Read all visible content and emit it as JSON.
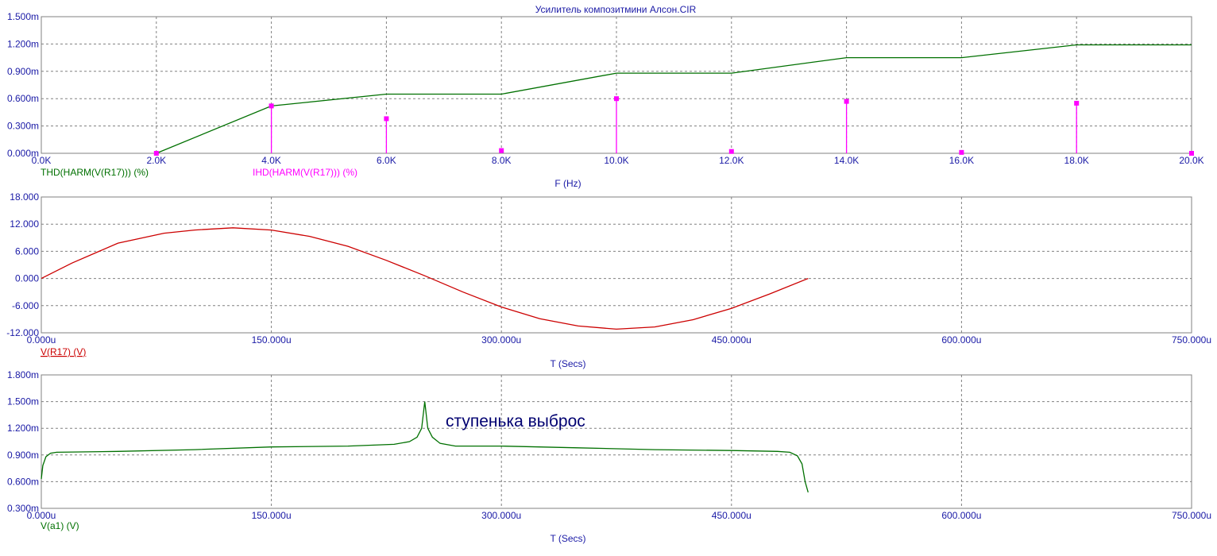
{
  "chart_data": [
    {
      "type": "line",
      "title": "Усилитель  композитмини Алсон.CIR",
      "xlabel": "F (Hz)",
      "xlim": [
        0,
        20000
      ],
      "ylim": [
        0,
        0.0015
      ],
      "grid": true,
      "x_ticks": [
        "0.0K",
        "2.0K",
        "4.0K",
        "6.0K",
        "8.0K",
        "10.0K",
        "12.0K",
        "14.0K",
        "16.0K",
        "18.0K",
        "20.0K"
      ],
      "y_ticks": [
        "0.000m",
        "0.300m",
        "0.600m",
        "0.900m",
        "1.200m",
        "1.500m"
      ],
      "series": [
        {
          "name": "THD(HARM(V(R17))) (%)",
          "color": "#007000",
          "style": "line",
          "x": [
            2000,
            4000,
            6000,
            8000,
            10000,
            12000,
            14000,
            16000,
            18000,
            20000
          ],
          "values": [
            0.0,
            0.00052,
            0.00065,
            0.00065,
            0.00088,
            0.00088,
            0.00105,
            0.00105,
            0.00119,
            0.00119
          ]
        },
        {
          "name": "IHD(HARM(V(R17))) (%)",
          "color": "#ff00ff",
          "style": "stem",
          "x": [
            2000,
            4000,
            6000,
            8000,
            10000,
            12000,
            14000,
            16000,
            18000,
            20000
          ],
          "values": [
            0.0,
            0.00052,
            0.00038,
            3e-05,
            0.0006,
            2e-05,
            0.00057,
            1e-05,
            0.00055,
            0.0
          ]
        }
      ]
    },
    {
      "type": "line",
      "xlabel": "T (Secs)",
      "xlim": [
        0,
        0.00075
      ],
      "ylim": [
        -12,
        18
      ],
      "grid": true,
      "x_ticks": [
        "0.000u",
        "150.000u",
        "300.000u",
        "450.000u",
        "600.000u",
        "750.000u"
      ],
      "y_ticks": [
        "-12.000",
        "-6.000",
        "0.000",
        "6.000",
        "12.000",
        "18.000"
      ],
      "series": [
        {
          "name": "V(R17) (V)",
          "color": "#cc0000",
          "x": [
            0,
            2e-05,
            5e-05,
            8e-05,
            0.0001,
            0.000125,
            0.00015,
            0.000175,
            0.0002,
            0.000225,
            0.00025,
            0.000275,
            0.0003,
            0.000325,
            0.00035,
            0.000375,
            0.0004,
            0.000425,
            0.00045,
            0.000475,
            0.0005
          ],
          "values": [
            0.0,
            3.4,
            7.8,
            10.0,
            10.7,
            11.2,
            10.7,
            9.3,
            7.1,
            4.0,
            0.6,
            -3.0,
            -6.3,
            -8.9,
            -10.5,
            -11.2,
            -10.7,
            -9.1,
            -6.6,
            -3.4,
            0.0
          ]
        }
      ]
    },
    {
      "type": "line",
      "xlabel": "T (Secs)",
      "xlim": [
        0,
        0.00075
      ],
      "ylim": [
        0.0003,
        0.0018
      ],
      "grid": true,
      "x_ticks": [
        "0.000u",
        "150.000u",
        "300.000u",
        "450.000u",
        "600.000u",
        "750.000u"
      ],
      "y_ticks": [
        "0.300m",
        "0.600m",
        "0.900m",
        "1.200m",
        "1.500m",
        "1.800m"
      ],
      "annotation": "ступенька выброс",
      "series": [
        {
          "name": "V(a1) (V)",
          "color": "#007000",
          "x": [
            0,
            1e-06,
            3e-06,
            6e-06,
            1e-05,
            5e-05,
            0.0001,
            0.00015,
            0.0002,
            0.00023,
            0.00024,
            0.000245,
            0.000248,
            0.00025,
            0.000252,
            0.000255,
            0.00026,
            0.00027,
            0.0003,
            0.00035,
            0.0004,
            0.00045,
            0.00048,
            0.000488,
            0.000493,
            0.000496,
            0.000498,
            0.0005
          ],
          "values": [
            0.00063,
            0.00078,
            0.00088,
            0.00092,
            0.00093,
            0.00094,
            0.00096,
            0.00099,
            0.001,
            0.00102,
            0.00105,
            0.0011,
            0.0012,
            0.0015,
            0.0012,
            0.0011,
            0.00103,
            0.001,
            0.001,
            0.00098,
            0.00096,
            0.00095,
            0.00094,
            0.00093,
            0.00089,
            0.0008,
            0.0006,
            0.00048
          ]
        }
      ]
    }
  ]
}
